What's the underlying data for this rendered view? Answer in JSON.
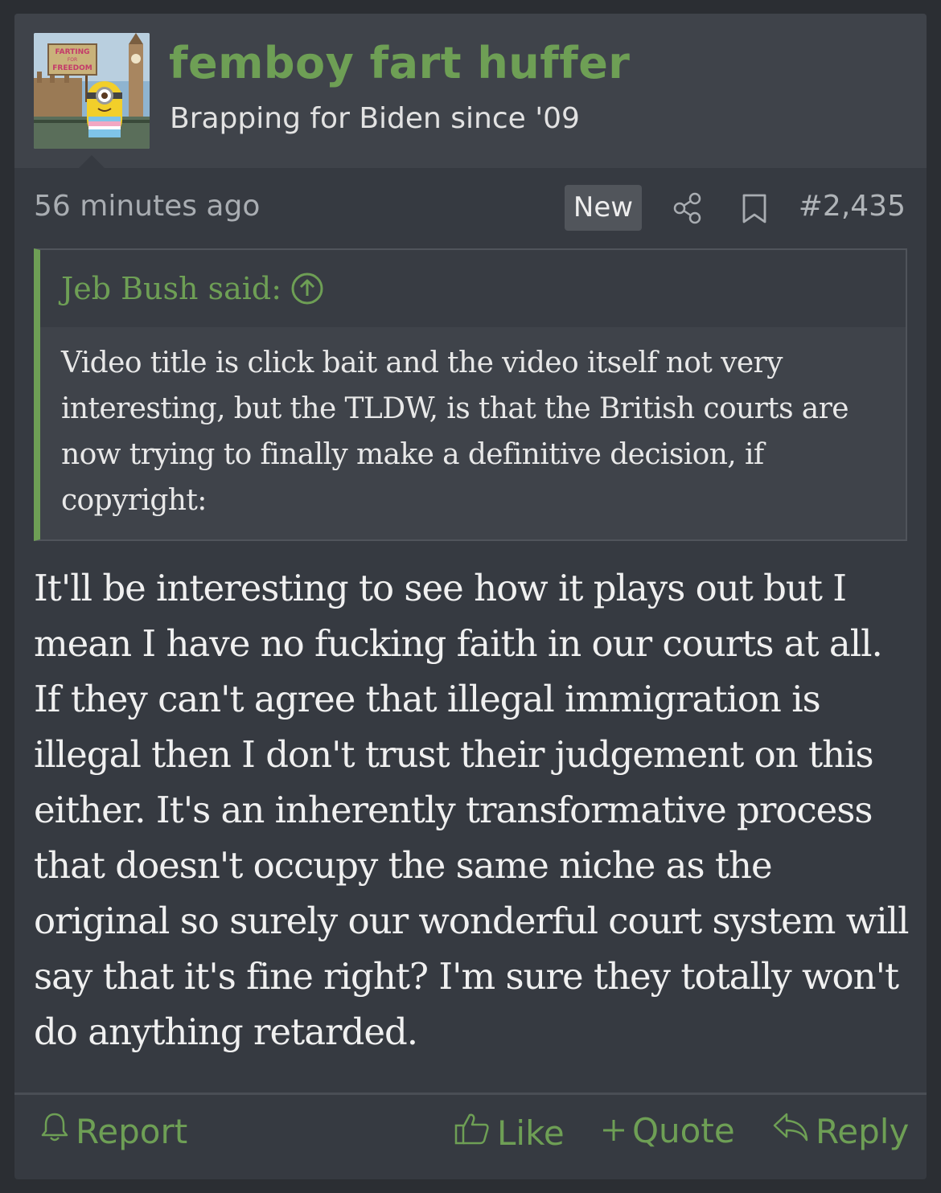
{
  "user": {
    "name": "femboy fart huffer",
    "title": "Brapping for Biden since '09",
    "avatar_sign": [
      "FARTING",
      "FOR",
      "FREEDOM"
    ]
  },
  "meta": {
    "time": "56 minutes ago",
    "badge": "New",
    "post_number": "#2,435"
  },
  "quote": {
    "author": "Jeb Bush said:",
    "text": "Video title is click bait and the video itself not very interesting, but the TLDW, is that the British courts are now trying to finally make a definitive decision, if copyright:"
  },
  "body": "It'll be interesting to see how it plays out but I mean I have no fucking faith in our courts at all. If they can't agree that illegal immigration is illegal then I don't trust their judgement on this either. It's an inherently transformative process that doesn't occupy the same niche as the original so surely our wonderful court system will say that it's fine right? I'm sure they totally won't do anything retarded.",
  "actions": {
    "report": "Report",
    "like": "Like",
    "quote": "Quote",
    "reply": "Reply"
  },
  "colors": {
    "accent": "#6e9f55",
    "background": "#363a41",
    "header": "#3f434a"
  }
}
